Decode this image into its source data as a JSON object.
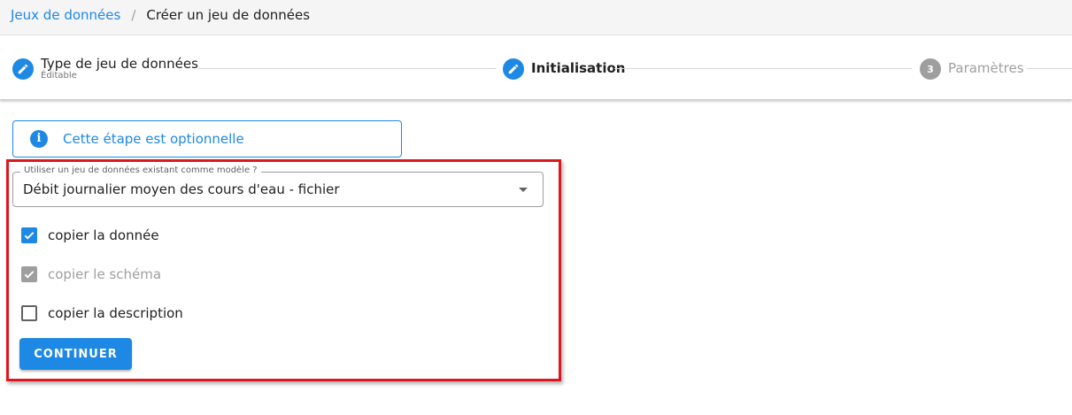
{
  "breadcrumb": {
    "parent": "Jeux de données",
    "separator": "/",
    "current": "Créer un jeu de données"
  },
  "stepper": {
    "steps": [
      {
        "title": "Type de jeu de données",
        "subtitle": "Éditable",
        "icon": "pencil-icon",
        "state": "completed"
      },
      {
        "title": "Initialisation",
        "icon": "pencil-icon",
        "state": "active"
      },
      {
        "number": "3",
        "title": "Paramètres",
        "state": "inactive"
      }
    ]
  },
  "alert": {
    "icon": "info-icon",
    "icon_glyph": "i",
    "text": "Cette étape est optionnelle"
  },
  "template_select": {
    "label": "Utiliser un jeu de données existant comme modèle ?",
    "value": "Débit journalier moyen des cours d'eau - fichier"
  },
  "options": [
    {
      "label": "copier la donnée",
      "checked": true,
      "disabled": false
    },
    {
      "label": "copier le schéma",
      "checked": true,
      "disabled": true
    },
    {
      "label": "copier la description",
      "checked": false,
      "disabled": false
    }
  ],
  "continue_button": {
    "label": "CONTINUER"
  },
  "colors": {
    "primary": "#1e88e5",
    "highlight": "#e0161e",
    "disabled": "#9e9e9e"
  }
}
